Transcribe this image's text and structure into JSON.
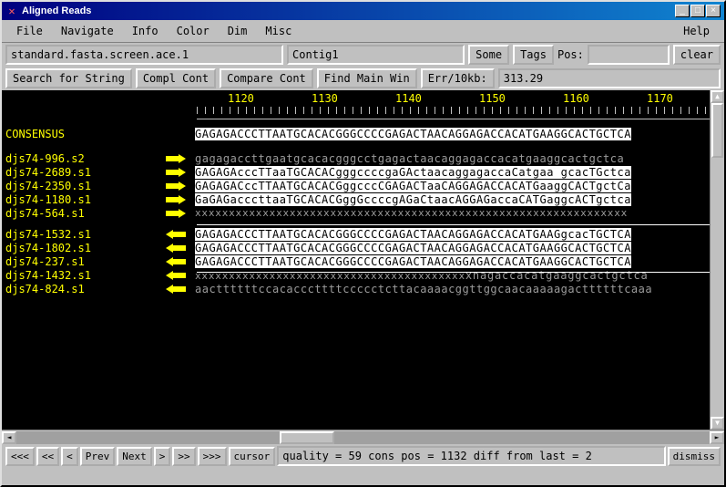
{
  "window": {
    "title": "Aligned Reads"
  },
  "menu": {
    "file": "File",
    "navigate": "Navigate",
    "info": "Info",
    "color": "Color",
    "dim": "Dim",
    "misc": "Misc",
    "help": "Help"
  },
  "toolbar1": {
    "file_path": "standard.fasta.screen.ace.1",
    "contig": "Contig1",
    "some": "Some",
    "tags": "Tags",
    "pos_label": "Pos:",
    "pos_val": "",
    "clear": "clear"
  },
  "toolbar2": {
    "search": "Search for String",
    "compl": "Compl Cont",
    "compare": "Compare Cont",
    "find_main": "Find Main Win",
    "err": "Err/10kb:",
    "err_val": "313.29"
  },
  "ruler": [
    "1120",
    "1130",
    "1140",
    "1150",
    "1160",
    "1170"
  ],
  "consensus_lbl": "CONSENSUS",
  "reads": {
    "consensus": "GAGAGACCCTTAATGCACACGGGCCCCGAGACTAACAGGAGACCACATGAAGGCACTGCTCA",
    "r1": {
      "name": "djs74-996.s2",
      "seq": "gagagaccttgaatgcacacgggcctgagactaacaggagaccacatgaaggcactgctca"
    },
    "r2": {
      "name": "djs74-2689.s1",
      "seq": "GAGAGAcccTTaaTGCACACgggccccgaGActaacaggagaccaCatgaa gcacTGctca"
    },
    "r3": {
      "name": "djs74-2350.s1",
      "seq": "GAGAGACccTTAATGCACACGggcccCGAGACTaaCAGGAGACCACATGaaggCACTgctCa"
    },
    "r4": {
      "name": "djs74-1180.s1",
      "seq": "GaGAGacccttaaTGCACACGggGccccgAGaCtaacAGGAGaccaCATGaggcACTgctca"
    },
    "r5": {
      "name": "djs74-564.s1"
    },
    "r6": {
      "name": "djs74-1532.s1",
      "seq": "GAGAGACCCTTAATGCACACGGGCCCCGAGACTAACAGGAGACCACATGAAGgcacTGCTCA"
    },
    "r7": {
      "name": "djs74-1802.s1",
      "seq": "GAGAGACCCTTAATGCACACGGGCCCCGAGACTAACAGGAGACCACATGAAGGCACTGCTCA"
    },
    "r8": {
      "name": "djs74-237.s1",
      "seq": "GAGAGACCCTTAATGCACACGGGCCCCGAGACTAACAGGAGACCACATGAAGGCACTGCTCA"
    },
    "r9": {
      "name": "djs74-1432.s1",
      "tail": "xnagaccacatgaaggcactgctca"
    },
    "r10": {
      "name": "djs74-824.s1",
      "seq": "aacttttttccacacccttttccccctcttacaaaacggttggcaacaaaaagacttttttcaaa"
    }
  },
  "nav": {
    "first": "<<<",
    "pageup": "<<",
    "up": "<",
    "prev": "Prev",
    "next": "Next",
    "down": ">",
    "pagedown": ">>",
    "last": ">>>",
    "cursor": "cursor"
  },
  "status": "quality = 59 cons pos = 1132 diff from last = 2",
  "dismiss": "dismiss"
}
